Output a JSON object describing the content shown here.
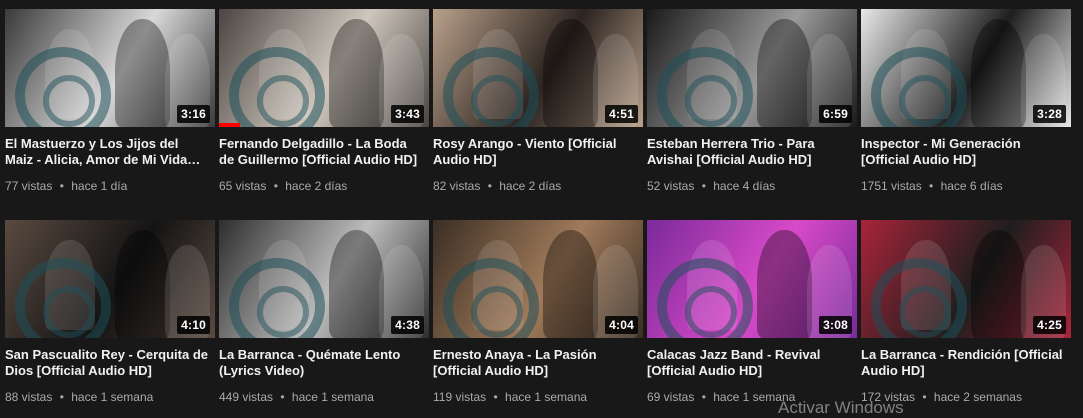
{
  "videos": [
    {
      "title": "El Mastuerzo y Los Jijos del Maiz - Alicia, Amor de Mi Vida [Official Audio HD]",
      "duration": "3:16",
      "views": "77 vistas",
      "age": "hace 1 día",
      "colors": [
        "#3a3a3a",
        "#d8d8d8"
      ]
    },
    {
      "title": "Fernando Delgadillo - La Boda de Guillermo [Official Audio HD]",
      "duration": "3:43",
      "views": "65 vistas",
      "age": "hace 2 días",
      "colors": [
        "#4a4542",
        "#cfc7bd"
      ],
      "watched": 0.1
    },
    {
      "title": "Rosy Arango - Viento [Official Audio HD]",
      "duration": "4:51",
      "views": "82 vistas",
      "age": "hace 2 días",
      "colors": [
        "#b9a08a",
        "#2c2420"
      ]
    },
    {
      "title": "Esteban Herrera Trio - Para Avishai [Official Audio HD]",
      "duration": "6:59",
      "views": "52 vistas",
      "age": "hace 4 días",
      "colors": [
        "#1a1a1a",
        "#9a9a9a"
      ]
    },
    {
      "title": "Inspector - Mi Generación [Official Audio HD]",
      "duration": "3:28",
      "views": "1751 vistas",
      "age": "hace 6 días",
      "colors": [
        "#e8e8e8",
        "#1e1e1e"
      ]
    },
    {
      "title": "San Pascualito Rey - Cerquita de Dios [Official Audio HD]",
      "duration": "4:10",
      "views": "88 vistas",
      "age": "hace 1 semana",
      "colors": [
        "#5a4a40",
        "#141414"
      ]
    },
    {
      "title": "La Barranca - Quémate Lento (Lyrics Video)",
      "duration": "4:38",
      "views": "449 vistas",
      "age": "hace 1 semana",
      "colors": [
        "#2e2e2e",
        "#bdbdbd"
      ]
    },
    {
      "title": "Ernesto Anaya - La Pasión [Official Audio HD]",
      "duration": "4:04",
      "views": "119 vistas",
      "age": "hace 1 semana",
      "colors": [
        "#3a2e24",
        "#a07a5a"
      ]
    },
    {
      "title": "Calacas Jazz Band - Revival [Official Audio HD]",
      "duration": "3:08",
      "views": "69 vistas",
      "age": "hace 1 semana",
      "colors": [
        "#7a2a9a",
        "#d84ac8"
      ]
    },
    {
      "title": "La Barranca - Rendición [Official Audio HD]",
      "duration": "4:25",
      "views": "172 vistas",
      "age": "hace 2 semanas",
      "colors": [
        "#a8243a",
        "#1e1e1e"
      ]
    }
  ],
  "overlay": {
    "activar": "Activar Windows"
  },
  "meta_separator": "•"
}
